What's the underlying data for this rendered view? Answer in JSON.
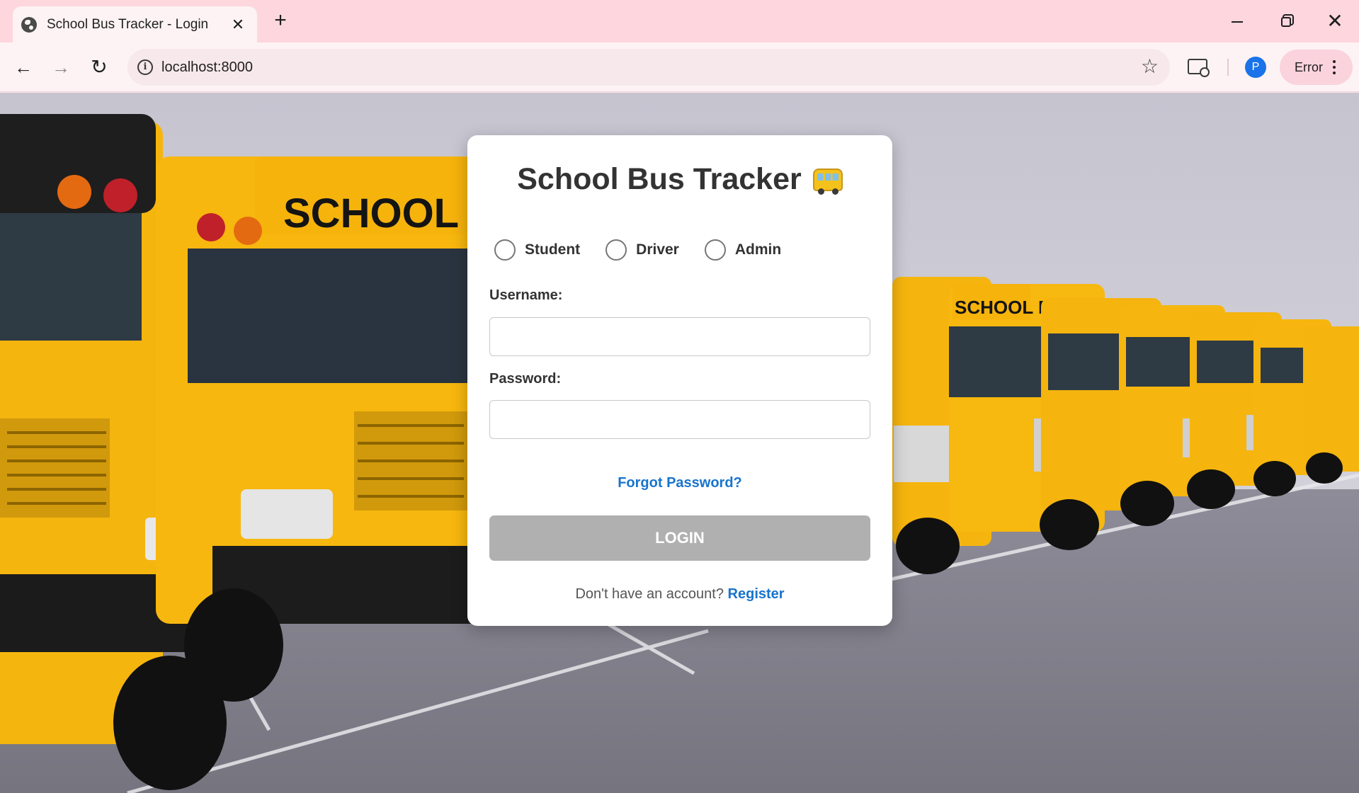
{
  "browser": {
    "tab_title": "School Bus Tracker - Login",
    "tab_close": "✕",
    "new_tab": "+",
    "url": "localhost:8000",
    "profile_initial": "P",
    "status_chip": "Error",
    "window_close": "✕"
  },
  "login": {
    "title": "School Bus Tracker",
    "title_icon": "bus-emoji",
    "roles": [
      {
        "label": "Student",
        "selected": false
      },
      {
        "label": "Driver",
        "selected": false
      },
      {
        "label": "Admin",
        "selected": false
      }
    ],
    "username_label": "Username:",
    "username_value": "",
    "password_label": "Password:",
    "password_value": "",
    "forgot_password": "Forgot Password?",
    "login_button": "LOGIN",
    "register_prompt": "Don't have an account?",
    "register_link": "Register"
  },
  "colors": {
    "tabbar_bg": "#fdd6de",
    "link": "#1874cd",
    "login_button_disabled": "#b0b0b0",
    "bus_yellow": "#f5b50f"
  },
  "background_image": {
    "subject": "yellow school buses parked in a row on a lot",
    "bus_sign_text": "SCHOOL BUS"
  }
}
